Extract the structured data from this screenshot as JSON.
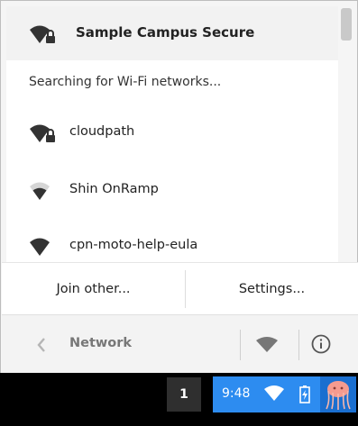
{
  "active_network": {
    "name": "Sample Campus Secure",
    "icon": "wifi-lock-icon"
  },
  "status_text": "Searching for Wi-Fi networks...",
  "networks": [
    {
      "name": "cloudpath",
      "icon": "wifi-lock-icon"
    },
    {
      "name": "Shin OnRamp",
      "icon": "wifi-weak-icon"
    },
    {
      "name": "cpn-moto-help-eula",
      "icon": "wifi-icon"
    }
  ],
  "actions": {
    "join_label": "Join other...",
    "settings_label": "Settings..."
  },
  "footer": {
    "title": "Network"
  },
  "shelf": {
    "workspace": "1",
    "time": "9:48"
  },
  "colors": {
    "tray_blue": "#2d8cf0",
    "panel_bg": "#f5f5f5",
    "text": "#222222"
  }
}
